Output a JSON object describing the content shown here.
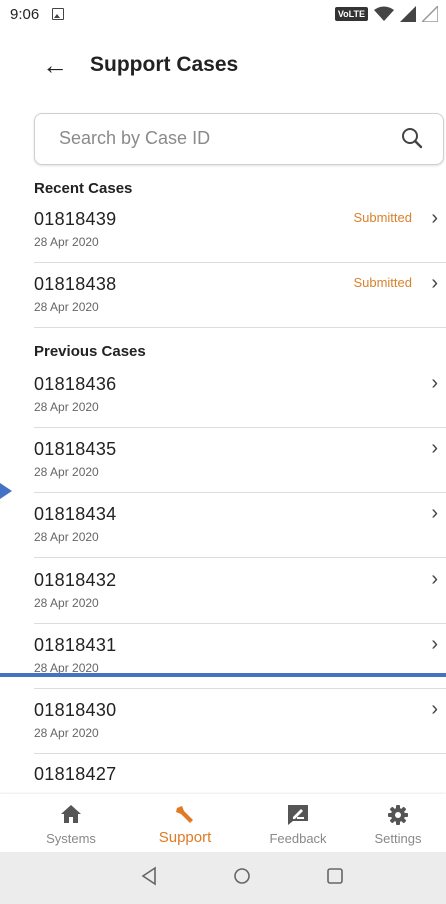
{
  "status_bar": {
    "time": "9:06",
    "network_badge": "VoLTE"
  },
  "header": {
    "title": "Support Cases"
  },
  "search": {
    "placeholder": "Search by Case ID",
    "value": ""
  },
  "sections": {
    "recent": {
      "title": "Recent Cases",
      "cases": [
        {
          "id": "01818439",
          "date": "28 Apr 2020",
          "status": "Submitted"
        },
        {
          "id": "01818438",
          "date": "28 Apr 2020",
          "status": "Submitted"
        }
      ]
    },
    "previous": {
      "title": "Previous Cases",
      "cases": [
        {
          "id": "01818436",
          "date": "28 Apr 2020"
        },
        {
          "id": "01818435",
          "date": "28 Apr 2020"
        },
        {
          "id": "01818434",
          "date": "28 Apr 2020"
        },
        {
          "id": "01818432",
          "date": "28 Apr 2020"
        },
        {
          "id": "01818431",
          "date": "28 Apr 2020"
        },
        {
          "id": "01818430",
          "date": "28 Apr 2020"
        },
        {
          "id": "01818427",
          "date": ""
        }
      ]
    }
  },
  "bottom_nav": {
    "items": [
      {
        "label": "Systems",
        "icon": "home-icon"
      },
      {
        "label": "Support",
        "icon": "wrench-icon",
        "active": true
      },
      {
        "label": "Feedback",
        "icon": "feedback-icon"
      },
      {
        "label": "Settings",
        "icon": "gear-icon"
      }
    ]
  },
  "colors": {
    "accent": "#e07b24",
    "status_submitted": "#d9822b",
    "annotation_blue": "#4472c4"
  }
}
